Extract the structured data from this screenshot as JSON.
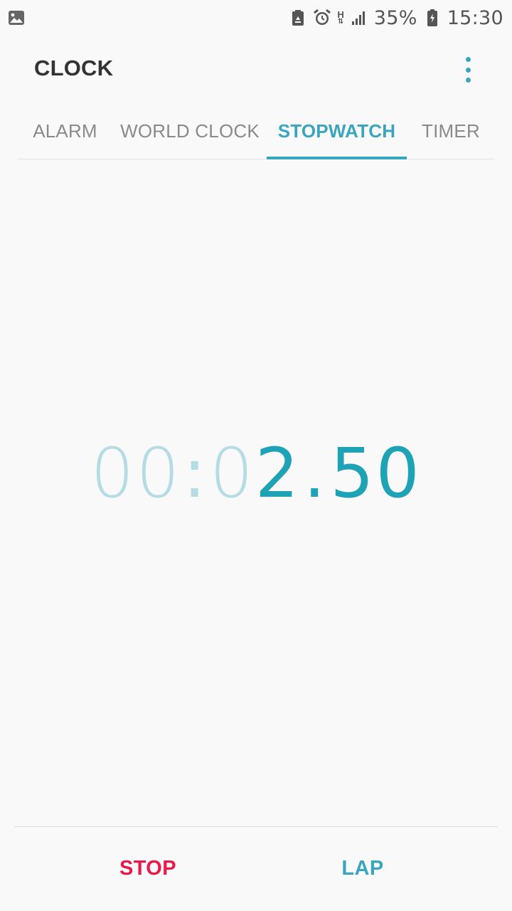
{
  "status_bar": {
    "left_icons": [
      "gallery-icon"
    ],
    "right_icons": [
      "battery-saver-icon",
      "alarm-clock-icon",
      "network-h-icon",
      "signal-icon",
      "battery-charging-icon"
    ],
    "network_type": "H",
    "battery": "35%",
    "time": "15:30"
  },
  "app_bar": {
    "title": "CLOCK",
    "more_icon": "more-vert-icon"
  },
  "tabs": [
    {
      "label": "ALARM",
      "active": false
    },
    {
      "label": "WORLD CLOCK",
      "active": false
    },
    {
      "label": "STOPWATCH",
      "active": true
    },
    {
      "label": "TIMER",
      "active": false
    }
  ],
  "stopwatch": {
    "dim_minutes": "00",
    "colon": ":",
    "dim_seconds_tens": "0",
    "bright_seconds_ones": "2",
    "dot": ".",
    "hundredths": "50"
  },
  "actions": {
    "stop_label": "STOP",
    "lap_label": "LAP"
  },
  "colors": {
    "accent": "#3aa6bd",
    "timer_bright": "#1ea3b6",
    "timer_dim": "#b5dbe3",
    "stop": "#e8194b",
    "background": "#f9f9f9"
  }
}
